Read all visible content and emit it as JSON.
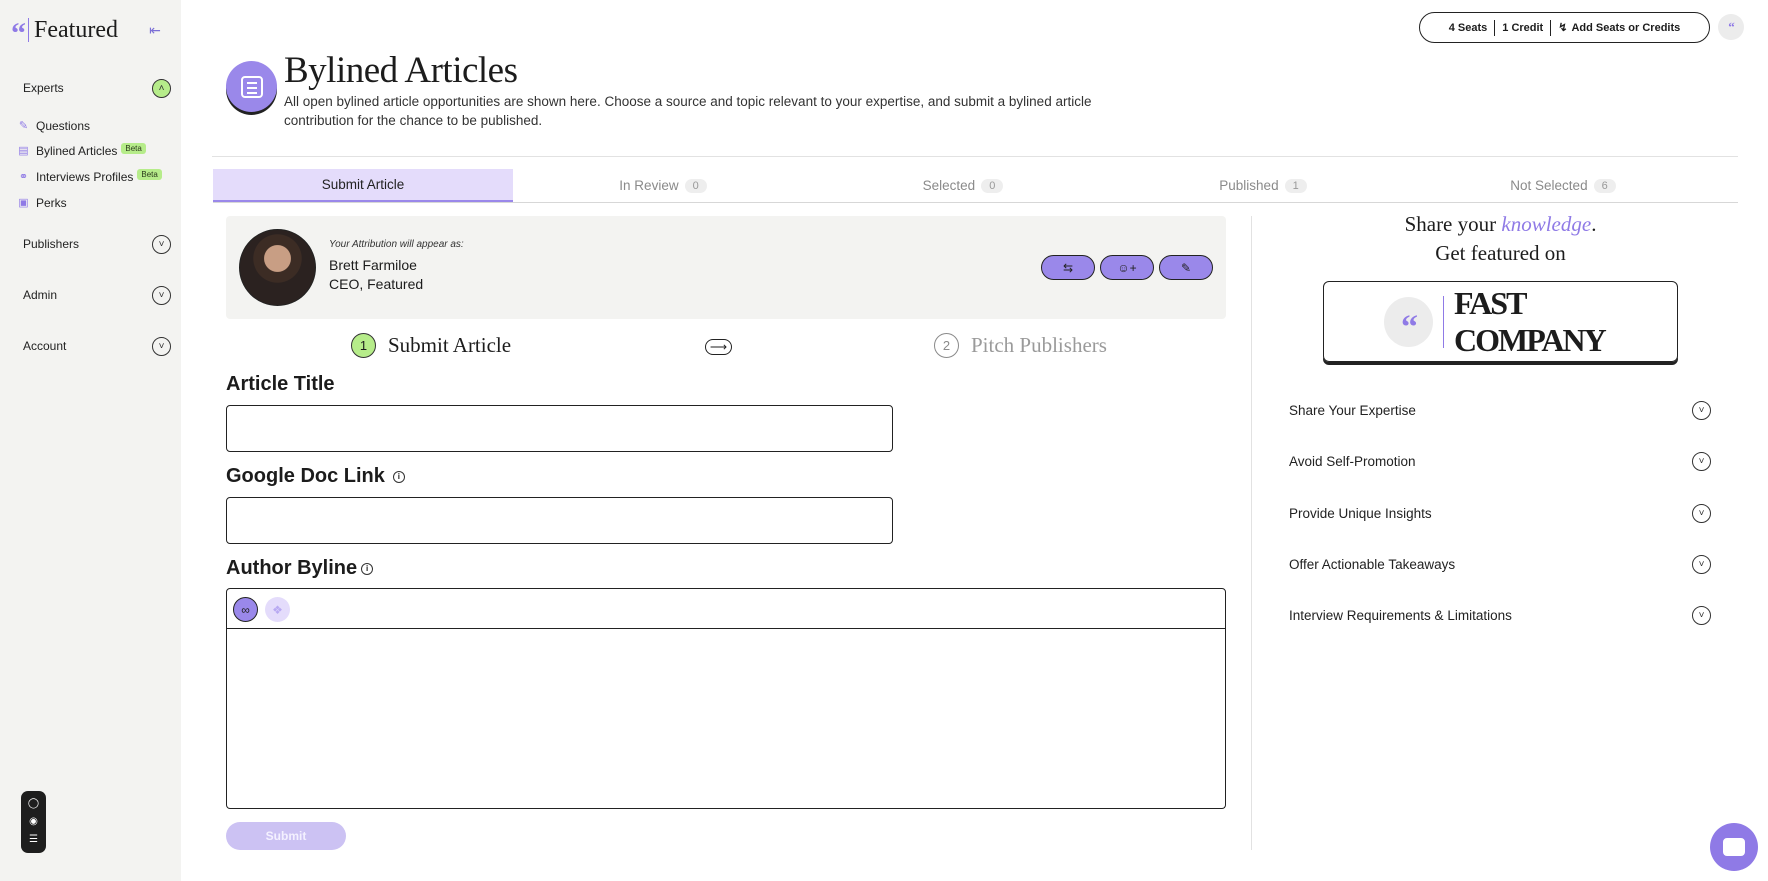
{
  "brand": {
    "name": "Featured"
  },
  "sidebar": {
    "sections": {
      "experts": "Experts",
      "publishers": "Publishers",
      "admin": "Admin",
      "account": "Account"
    },
    "items": [
      {
        "label": "Questions",
        "icon": "questions-icon",
        "badge": ""
      },
      {
        "label": "Bylined Articles",
        "icon": "articles-icon",
        "badge": "Beta"
      },
      {
        "label": "Interviews Profiles",
        "icon": "mic-icon",
        "badge": "Beta"
      },
      {
        "label": "Perks",
        "icon": "gift-icon",
        "badge": ""
      }
    ]
  },
  "topbar": {
    "seats": "4 Seats",
    "credits": "1 Credit",
    "add": "Add Seats or Credits"
  },
  "header": {
    "title": "Bylined Articles",
    "description": "All open bylined article opportunities are shown here. Choose a source and topic relevant to your expertise, and submit a bylined article contribution for the chance to be published."
  },
  "tabs": [
    {
      "label": "Submit Article",
      "count": ""
    },
    {
      "label": "In Review",
      "count": "0"
    },
    {
      "label": "Selected",
      "count": "0"
    },
    {
      "label": "Published",
      "count": "1"
    },
    {
      "label": "Not Selected",
      "count": "6"
    }
  ],
  "attribution": {
    "note": "Your Attribution will appear as:",
    "name": "Brett Farmiloe",
    "title": "CEO, Featured"
  },
  "stepper": {
    "step1_num": "1",
    "step1_label": "Submit Article",
    "step2_num": "2",
    "step2_label": "Pitch Publishers"
  },
  "form": {
    "title_label": "Article Title",
    "doc_label": "Google Doc Link",
    "byline_label": "Author Byline",
    "submit_label": "Submit"
  },
  "promo": {
    "line1_start": "Share your ",
    "line1_highlight": "knowledge",
    "line1_end": ".",
    "line2": "Get featured on",
    "publication": "FAST COMPANY"
  },
  "accordion": [
    "Share Your Expertise",
    "Avoid Self-Promotion",
    "Provide Unique Insights",
    "Offer Actionable Takeaways",
    "Interview Requirements & Limitations"
  ],
  "colors": {
    "accent": "#9a88ea",
    "highlight": "#b6ec8a",
    "sidebar_bg": "#f3f3f1"
  }
}
